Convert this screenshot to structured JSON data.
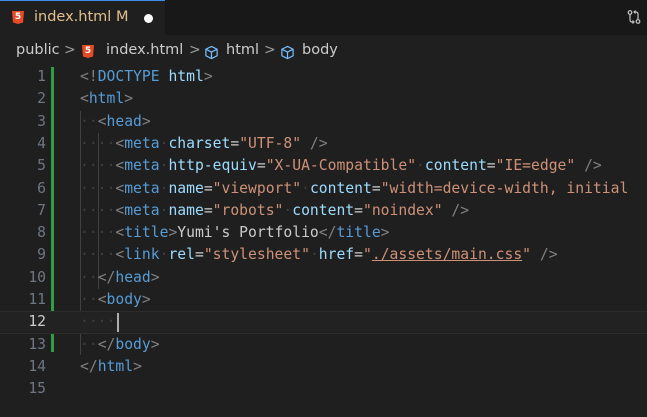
{
  "tab": {
    "icon_letter": "5",
    "filename": "index.html",
    "git_status": "M"
  },
  "breadcrumb": {
    "folder": "public",
    "file": "index.html",
    "html_element": "html",
    "body_element": "body",
    "separator": ">"
  },
  "editor": {
    "line_numbers": [
      "1",
      "2",
      "3",
      "4",
      "5",
      "6",
      "7",
      "8",
      "9",
      "10",
      "11",
      "12",
      "13",
      "14",
      "15"
    ],
    "active_line": "12"
  },
  "colors": {
    "tag_bracket": "#808080",
    "tag_name": "#569cd6",
    "attr_name": "#9cdcfe",
    "attr_value": "#ce9178",
    "text": "#cccccc",
    "modified": "#e2c08d",
    "gutter_modified": "#2ea043"
  },
  "code": {
    "l1": {
      "open": "<!",
      "doctype": "DOCTYPE",
      "sp": " ",
      "html": "html",
      "close": ">"
    },
    "l2": {
      "open": "<",
      "tag": "html",
      "close": ">"
    },
    "l3": {
      "open": "<",
      "tag": "head",
      "close": ">"
    },
    "l4": {
      "open": "<",
      "tag": "meta",
      "a1": "charset",
      "eq": "=",
      "v1": "\"UTF-8\"",
      "close": " />"
    },
    "l5": {
      "open": "<",
      "tag": "meta",
      "a1": "http-equiv",
      "eq": "=",
      "v1": "\"X-UA-Compatible\"",
      "a2": "content",
      "v2": "\"IE=edge\"",
      "close": " />"
    },
    "l6": {
      "open": "<",
      "tag": "meta",
      "a1": "name",
      "eq": "=",
      "v1": "\"viewport\"",
      "a2": "content",
      "v2": "\"width=device-width, initial"
    },
    "l7": {
      "open": "<",
      "tag": "meta",
      "a1": "name",
      "eq": "=",
      "v1": "\"robots\"",
      "a2": "content",
      "v2": "\"noindex\"",
      "close": " />"
    },
    "l8": {
      "open": "<",
      "tag": "title",
      "close": ">",
      "text": "Yumi's Portfolio",
      "end_open": "</",
      "end_close": ">"
    },
    "l9": {
      "open": "<",
      "tag": "link",
      "a1": "rel",
      "eq": "=",
      "v1": "\"stylesheet\"",
      "a2": "href",
      "q1": "\"",
      "v2": "./assets/main.css",
      "q2": "\"",
      "close": " />"
    },
    "l10": {
      "open": "</",
      "tag": "head",
      "close": ">"
    },
    "l11": {
      "open": "<",
      "tag": "body",
      "close": ">"
    },
    "l13": {
      "open": "</",
      "tag": "body",
      "close": ">"
    },
    "l14": {
      "open": "</",
      "tag": "html",
      "close": ">"
    }
  }
}
